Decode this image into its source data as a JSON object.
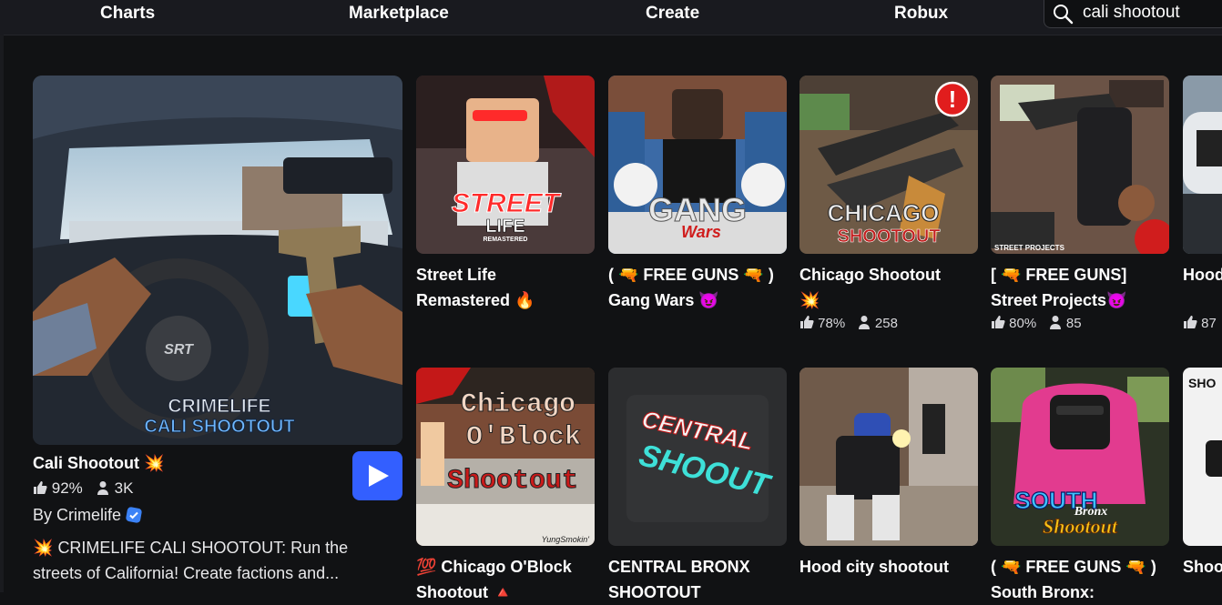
{
  "nav": {
    "charts": "Charts",
    "marketplace": "Marketplace",
    "create": "Create",
    "robux": "Robux"
  },
  "search": {
    "value": "cali shootout",
    "icon": "search-icon"
  },
  "featured": {
    "title": "Cali Shootout",
    "title_emoji": "💥",
    "rating": "92%",
    "players": "3K",
    "by": "By Crimelife",
    "description_emoji": "💥",
    "description": "CRIMELIFE CALI SHOOTOUT: Run the streets of California! Create factions and...",
    "thumb_logo_line1": "CRIMELIFE",
    "thumb_logo_line2": "CALI SHOOTOUT",
    "thumb_wheel": "SRT"
  },
  "games": [
    {
      "title": "Street Life Remastered",
      "emoji": "🔥",
      "rating": "",
      "players": "",
      "logo1": "STREET",
      "logo2": "LIFE",
      "logo3": "REMASTERED"
    },
    {
      "title": "( 🔫 FREE GUNS 🔫 ) Gang Wars",
      "emoji": "😈",
      "rating": "",
      "players": "",
      "logo1": "GANG",
      "logo2": "Wars"
    },
    {
      "title": "Chicago Shootout",
      "emoji": "💥",
      "rating": "78%",
      "players": "258",
      "logo1": "CHICAGO",
      "logo2": "SHOOTOUT",
      "alert": "!"
    },
    {
      "title": "[ 🔫 FREE GUNS] Street Projects",
      "emoji": "😈",
      "rating": "80%",
      "players": "85",
      "logo1": "STREET PROJECTS"
    },
    {
      "title": "Hood",
      "emoji": "",
      "rating": "87",
      "players": ""
    },
    {
      "title": "💯 Chicago O'Block Shootout",
      "emoji": "🔺",
      "rating": "",
      "players": "",
      "logo1": "Chicago",
      "logo2": "O'Block",
      "logo3": "Shootout",
      "logo4": "YungSmokin'"
    },
    {
      "title": "CENTRAL BRONX SHOOTOUT",
      "emoji": "",
      "rating": "",
      "players": "",
      "logo1": "CENTRAL",
      "logo2": "SHOOUT"
    },
    {
      "title": "Hood city shootout",
      "emoji": "",
      "rating": "",
      "players": ""
    },
    {
      "title": "( 🔫 FREE GUNS 🔫 ) South Bronx:",
      "emoji": "",
      "rating": "",
      "players": "",
      "logo1": "SOUTH",
      "logo2": "Bronx",
      "logo3": "Shootout"
    },
    {
      "title": "Shoo UPD",
      "emoji": "",
      "rating": "",
      "players": "",
      "logo1": "SHO"
    }
  ],
  "colors": {
    "accent": "#335fff",
    "bg": "#111214",
    "topbar": "#191a1f"
  }
}
